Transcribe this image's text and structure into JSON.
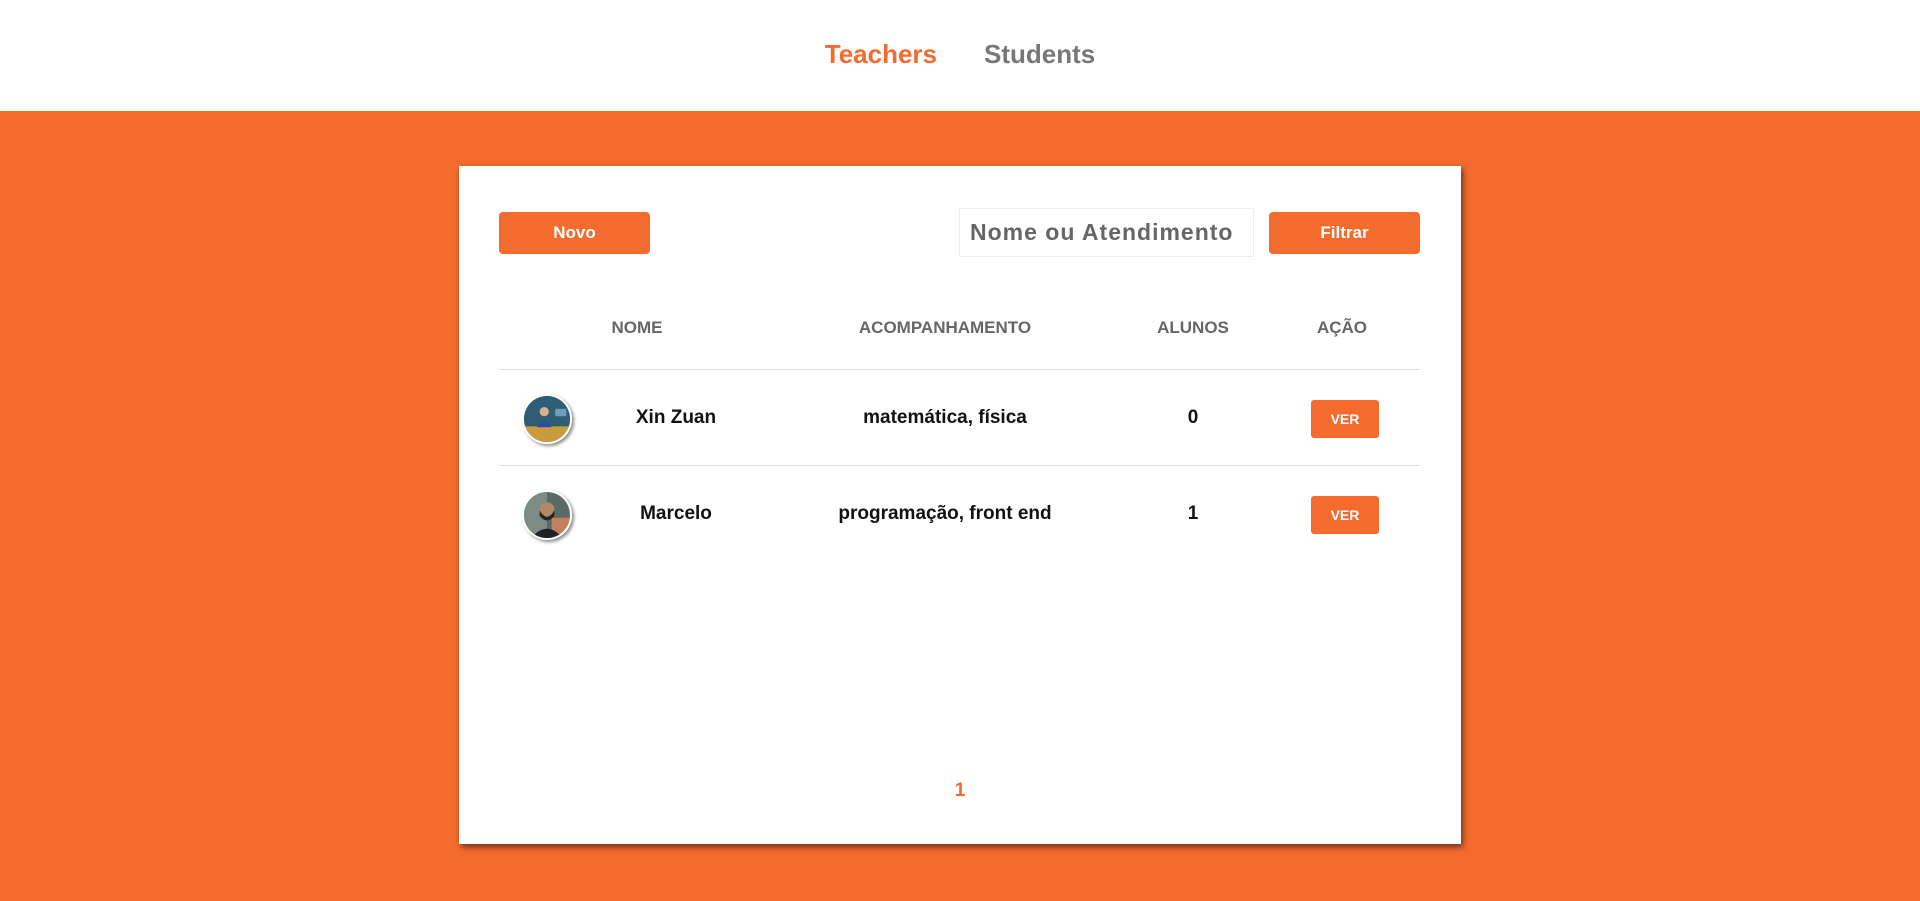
{
  "nav": {
    "tabs": [
      {
        "label": "Teachers",
        "active": true
      },
      {
        "label": "Students",
        "active": false
      }
    ]
  },
  "toolbar": {
    "new_label": "Novo",
    "search_placeholder": "Nome ou Atendimento",
    "filter_label": "Filtrar"
  },
  "table": {
    "columns": [
      "NOME",
      "ACOMPANHAMENTO",
      "ALUNOS",
      "AÇÃO"
    ],
    "rows": [
      {
        "name": "Xin Zuan",
        "subjects": "matemática, física",
        "students": "0",
        "action": "VER"
      },
      {
        "name": "Marcelo",
        "subjects": "programação, front end",
        "students": "1",
        "action": "VER"
      }
    ]
  },
  "pagination": {
    "current_page": "1"
  },
  "colors": {
    "accent": "#f46b2e",
    "muted": "#777777"
  }
}
